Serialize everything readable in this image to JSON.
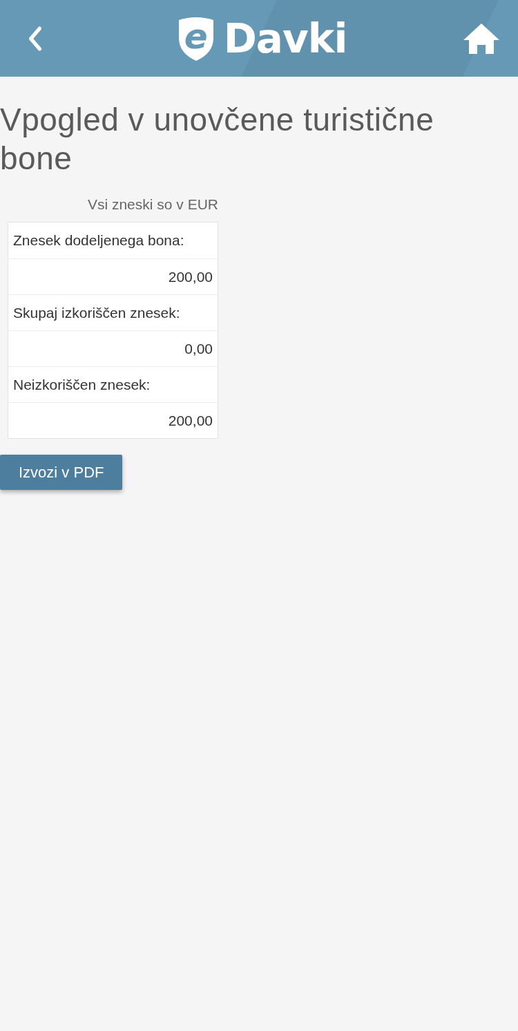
{
  "header": {
    "logo": {
      "mark": "e",
      "name": "Davki"
    }
  },
  "title": "Vpogled v unovčene turistične bone",
  "currency_note": "Vsi zneski so v EUR",
  "summary": [
    {
      "label": "Znesek dodeljenega bona:",
      "value": "200,00"
    },
    {
      "label": "Skupaj izkoriščen znesek:",
      "value": "0,00"
    },
    {
      "label": "Neizkoriščen znesek:",
      "value": "200,00"
    }
  ],
  "buttons": [
    {
      "label": "Izvozi v PDF"
    }
  ]
}
